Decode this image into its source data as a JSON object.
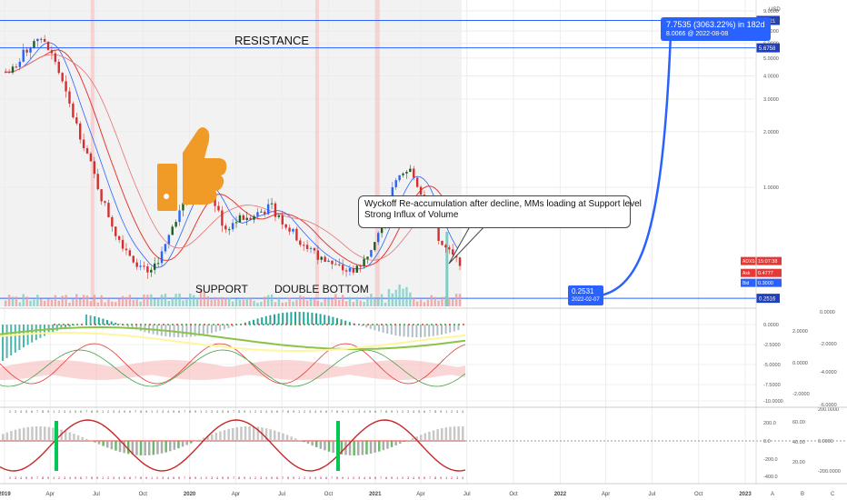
{
  "chart_data": {
    "type": "candlestick",
    "currency": "USD",
    "price_axis": {
      "ticks": [
        "9.0000",
        "8.0000",
        "7.0000",
        "6.0000",
        "5.0000",
        "4.0000",
        "3.0000",
        "2.0000",
        "1.0000"
      ],
      "ylim": [
        0,
        9.2
      ],
      "scale": "log"
    },
    "time_axis": {
      "ticks": [
        "2019",
        "Apr",
        "Jul",
        "Oct",
        "2020",
        "Apr",
        "Jul",
        "Oct",
        "2021",
        "Apr",
        "Jul",
        "Oct",
        "2022",
        "Apr",
        "Jul",
        "Oct",
        "2023"
      ]
    },
    "candles": [
      {
        "date": "2019-01",
        "close": 4.2
      },
      {
        "date": "2019-02",
        "close": 5.4
      },
      {
        "date": "2019-03",
        "close": 6.6
      },
      {
        "date": "2019-04",
        "close": 4.9
      },
      {
        "date": "2019-05",
        "close": 2.7
      },
      {
        "date": "2019-06",
        "close": 1.6
      },
      {
        "date": "2019-07",
        "close": 0.9
      },
      {
        "date": "2019-08",
        "close": 0.55
      },
      {
        "date": "2019-09",
        "close": 0.42
      },
      {
        "date": "2019-10",
        "close": 0.34
      },
      {
        "date": "2019-11",
        "close": 0.45
      },
      {
        "date": "2019-12",
        "close": 0.75
      },
      {
        "date": "2020-01",
        "close": 1.1
      },
      {
        "date": "2020-02",
        "close": 0.95
      },
      {
        "date": "2020-03",
        "close": 0.6
      },
      {
        "date": "2020-04",
        "close": 0.68
      },
      {
        "date": "2020-05",
        "close": 0.72
      },
      {
        "date": "2020-06",
        "close": 0.78
      },
      {
        "date": "2020-07",
        "close": 0.62
      },
      {
        "date": "2020-08",
        "close": 0.5
      },
      {
        "date": "2020-09",
        "close": 0.42
      },
      {
        "date": "2020-10",
        "close": 0.38
      },
      {
        "date": "2020-11",
        "close": 0.35
      },
      {
        "date": "2020-12",
        "close": 0.4
      },
      {
        "date": "2021-01",
        "close": 0.62
      },
      {
        "date": "2021-02",
        "close": 1.05
      },
      {
        "date": "2021-03",
        "close": 1.25
      },
      {
        "date": "2021-04",
        "close": 0.85
      },
      {
        "date": "2021-05",
        "close": 0.5
      },
      {
        "date": "2021-06",
        "close": 0.4
      }
    ],
    "horizontal_lines": [
      {
        "label": "7.9821",
        "value": 7.9821
      },
      {
        "label": "5.6758",
        "value": 5.6758
      },
      {
        "label": "0.2516",
        "value": 0.2516
      }
    ],
    "price_labels": {
      "ask_label": "Ask",
      "ask_value": "0.4777",
      "bid_label": "Bid",
      "bid_value": "0.3000",
      "last_label": "ADXS",
      "last_value": "15:07:38"
    },
    "projection": {
      "start": {
        "date": "2022-02-07",
        "price": 0.2531,
        "price_text": "0.2531",
        "date_text": "2022-02-07"
      },
      "end": {
        "date": "2022-08-08",
        "price": 7.9821
      },
      "main_text": "7.7535 (3063.22%) in 182d",
      "sub_text": "8.0066 @ 2022-08-08"
    },
    "annotations": {
      "resistance": "RESISTANCE",
      "support": "SUPPORT",
      "double_bottom": "DOUBLE BOTTOM",
      "callout_lines": [
        "Wyckoff Re-accumulation after decline, MMs loading at Support level",
        "Strong Influx of Volume"
      ]
    },
    "indicator1": {
      "left_axis": [
        "0.0000",
        "-2.5000",
        "-5.0000",
        "-7.5000",
        "-10.0000"
      ],
      "right_axis": [
        "0.0000",
        "2.0000",
        "-2.0000",
        "0.0000",
        "-4.0000",
        "-2.0000",
        "-6.0000"
      ]
    },
    "indicator2": {
      "left_axis": [
        "200.0",
        "0.0",
        "-200.0",
        "-400.0"
      ],
      "mid_axis": [
        "60.00",
        "40.00",
        "20.00"
      ],
      "right_axis": [
        "200.0000",
        "0.0000",
        "-200.0000"
      ]
    },
    "layout_buttons": [
      "A",
      "B",
      "C"
    ]
  }
}
